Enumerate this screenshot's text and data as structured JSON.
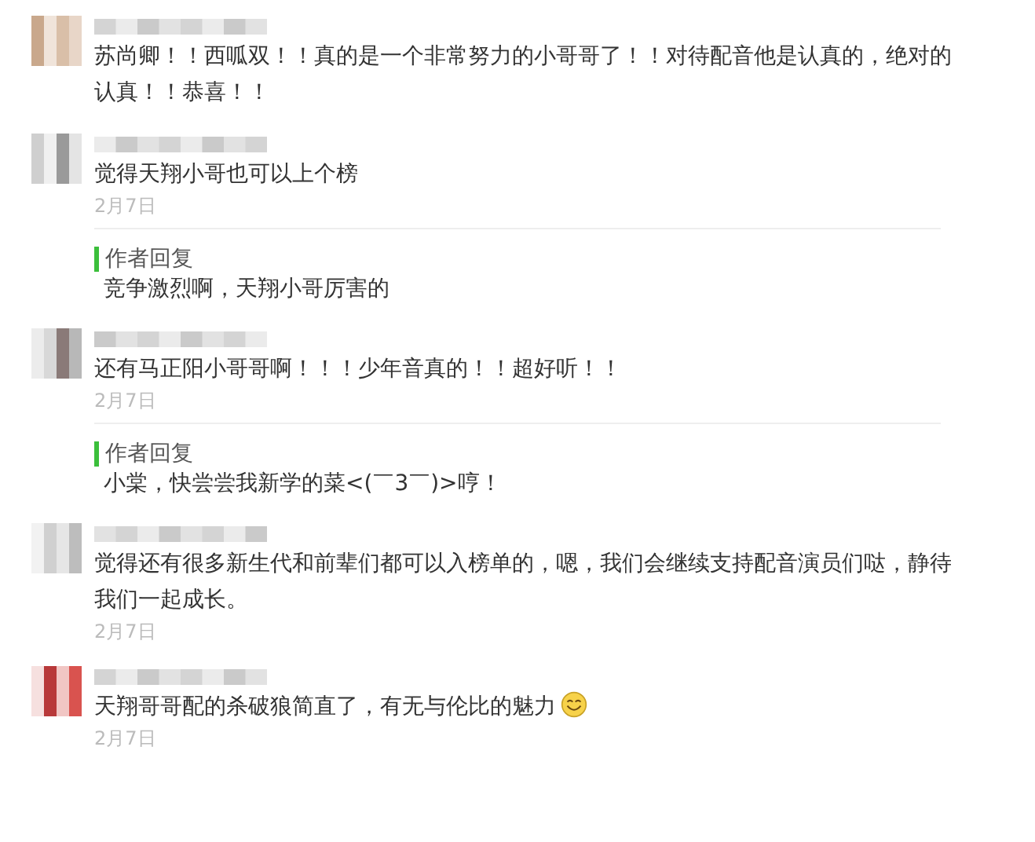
{
  "comments": [
    {
      "text": "苏尚卿！！西呱双！！真的是一个非常努力的小哥哥了！！对待配音他是认真的，绝对的认真！！恭喜！！",
      "emoji": false
    },
    {
      "text": "觉得天翔小哥也可以上个榜",
      "date": "2月7日",
      "emoji": false,
      "reply": {
        "label": "作者回复",
        "text": "竞争激烈啊，天翔小哥厉害的"
      }
    },
    {
      "text": "还有马正阳小哥哥啊！！！少年音真的！！超好听！！",
      "date": "2月7日",
      "emoji": false,
      "reply": {
        "label": "作者回复",
        "text": "小棠，快尝尝我新学的菜<(￣3￣)>哼！"
      }
    },
    {
      "text": "觉得还有很多新生代和前辈们都可以入榜单的，嗯，我们会继续支持配音演员们哒，静待我们一起成长。",
      "date": "2月7日",
      "emoji": false
    },
    {
      "text": "天翔哥哥配的杀破狼简直了，有无与伦比的魅力",
      "date": "2月7日",
      "emoji": true
    }
  ]
}
